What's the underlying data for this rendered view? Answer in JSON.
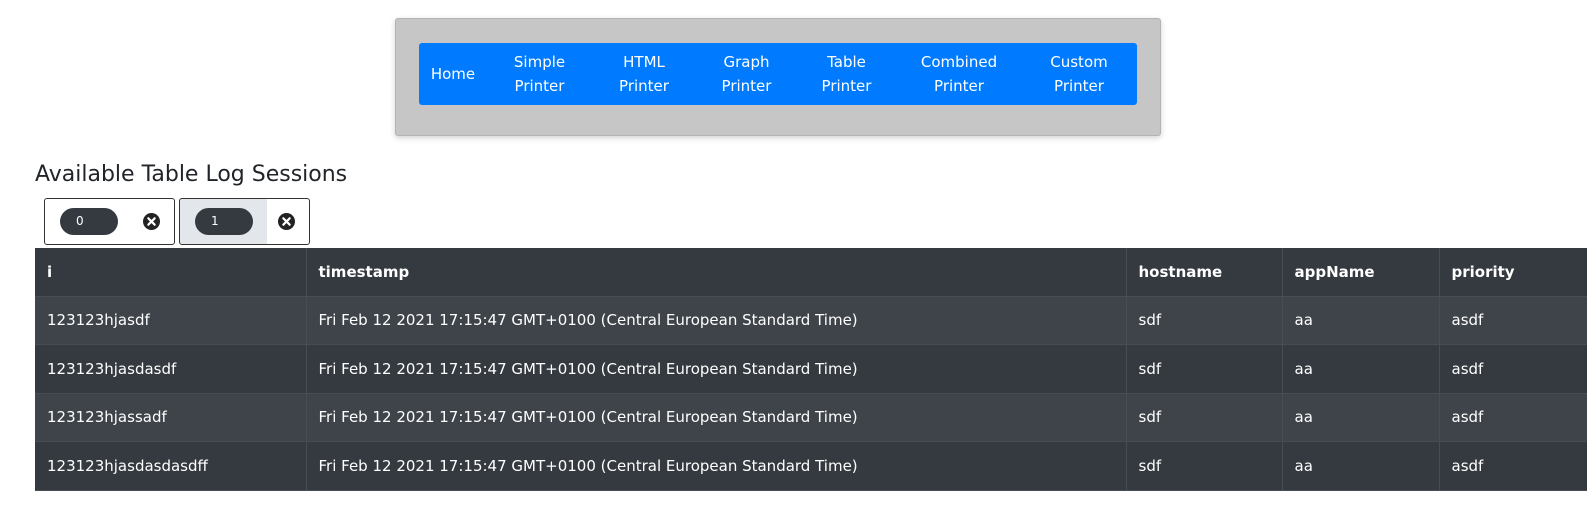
{
  "nav": {
    "items": [
      {
        "label": "Home"
      },
      {
        "label": "Simple\nPrinter"
      },
      {
        "label": "HTML\nPrinter"
      },
      {
        "label": "Graph\nPrinter"
      },
      {
        "label": "Table\nPrinter"
      },
      {
        "label": "Combined\nPrinter"
      },
      {
        "label": "Custom\nPrinter"
      }
    ]
  },
  "page": {
    "title": "Available Table Log Sessions"
  },
  "sessions": {
    "tabs": [
      {
        "label": "0",
        "active": false
      },
      {
        "label": "1",
        "active": true
      }
    ]
  },
  "table": {
    "columns": [
      "i",
      "timestamp",
      "hostname",
      "appName",
      "priority"
    ],
    "rows": [
      [
        "123123hjasdf",
        "Fri Feb 12 2021 17:15:47 GMT+0100 (Central European Standard Time)",
        "sdf",
        "aa",
        "asdf"
      ],
      [
        "123123hjasdasdf",
        "Fri Feb 12 2021 17:15:47 GMT+0100 (Central European Standard Time)",
        "sdf",
        "aa",
        "asdf"
      ],
      [
        "123123hjassadf",
        "Fri Feb 12 2021 17:15:47 GMT+0100 (Central European Standard Time)",
        "sdf",
        "aa",
        "asdf"
      ],
      [
        "123123hjasdasdasdff",
        "Fri Feb 12 2021 17:15:47 GMT+0100 (Central European Standard Time)",
        "sdf",
        "aa",
        "asdf"
      ]
    ]
  },
  "colors": {
    "nav_bg": "#007bff",
    "frame_bg": "#c6c6c6",
    "table_dark": "#343a40",
    "table_stripe": "#3e444a",
    "pill_bg": "#343a40"
  }
}
